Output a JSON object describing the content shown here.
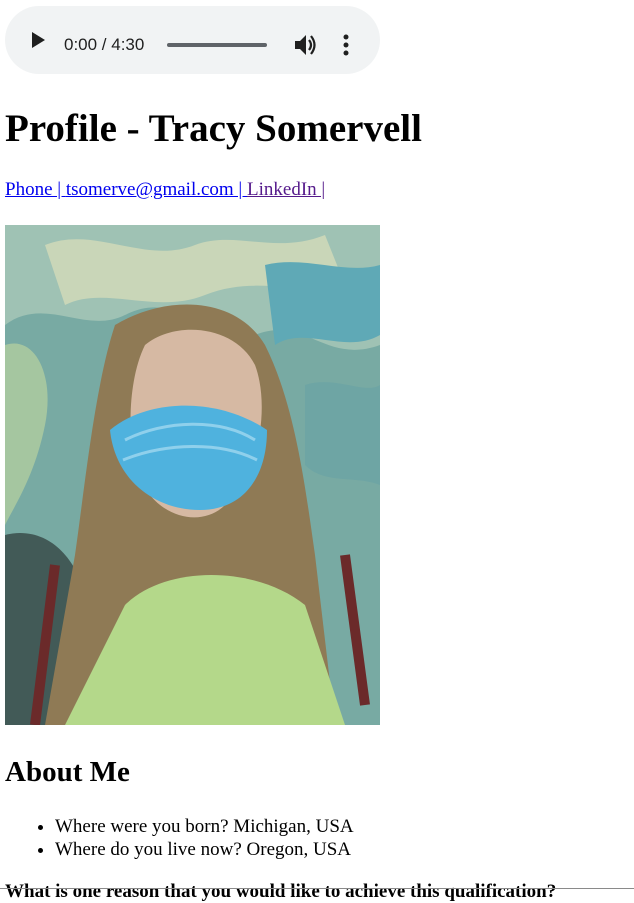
{
  "audio": {
    "time_display": "0:00 / 4:30",
    "progress": 0
  },
  "profile": {
    "title": "Profile - Tracy Somervell",
    "links": [
      {
        "label": "Phone | "
      },
      {
        "label": "tsomerve@gmail.com | "
      },
      {
        "label": "LinkedIn |"
      }
    ]
  },
  "about": {
    "heading": "About Me",
    "items": [
      "Where were you born? Michigan, USA",
      "Where do you live now? Oregon, USA"
    ],
    "next_question_partial": "What is one reason that you would like to achieve this qualification?"
  },
  "colors": {
    "link": "#0000ee",
    "link_visited": "#551a8b",
    "player_bg": "#f1f3f4"
  }
}
